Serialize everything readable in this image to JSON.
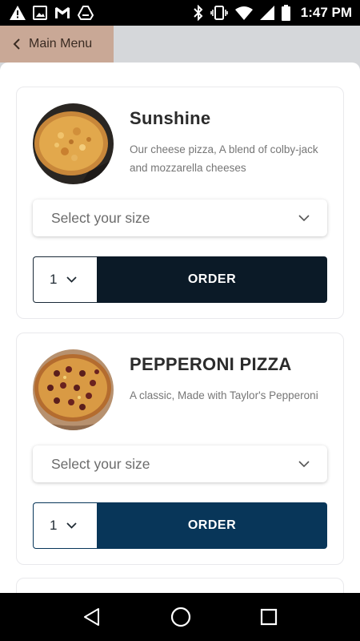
{
  "status_bar": {
    "time": "1:47 PM",
    "left_icons": [
      "warning-icon",
      "image-icon",
      "gmail-icon",
      "drive-icon"
    ],
    "right_icons": [
      "bluetooth-icon",
      "vibrate-icon",
      "wifi-icon",
      "signal-icon",
      "battery-icon"
    ]
  },
  "header": {
    "back_label": "Main Menu"
  },
  "menu_items": [
    {
      "title": "Sunshine",
      "description": "Our cheese pizza, A blend of colby-jack and mozzarella cheeses",
      "size_placeholder": "Select your size",
      "quantity": "1",
      "order_label": "ORDER"
    },
    {
      "title": "PEPPERONI PIZZA",
      "description": "A classic, Made with Taylor's Pepperoni",
      "size_placeholder": "Select your size",
      "quantity": "1",
      "order_label": "ORDER"
    }
  ],
  "nav_bar": {
    "icons": [
      "back-nav-icon",
      "home-nav-icon",
      "recents-nav-icon"
    ]
  },
  "colors": {
    "back_button": "#c9a896",
    "order_dark": "#0b1a27",
    "order_blue": "#083659"
  }
}
